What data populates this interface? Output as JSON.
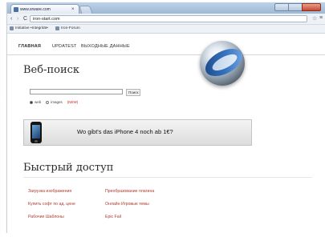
{
  "browser": {
    "tab_title": "www.srware.com",
    "tab_close": "×",
    "url": "iron-start.com",
    "nav": {
      "back": "‹",
      "forward": "›",
      "reload": "C"
    },
    "star": "☆",
    "wrench": "🔧",
    "bookmarks": [
      {
        "label": "Initiative •Integrität•"
      },
      {
        "label": "Iron-Forum"
      }
    ]
  },
  "site": {
    "nav": [
      "ГЛАВНАЯ",
      "UPDATEST",
      "ВЫХОДНЫЕ ДАННЫЕ"
    ],
    "web_search": {
      "title": "Веб-поиск",
      "button": "Поиск",
      "options": [
        {
          "label": "web",
          "selected": true
        },
        {
          "label": "images",
          "selected": false
        }
      ],
      "beta": "(NEW)"
    },
    "promo": {
      "text": "Wo gibt's das iPhone 4 noch ab 1€?"
    },
    "quick_access": {
      "title": "Быстрый доступ",
      "links": [
        [
          "Загрузка изображения",
          "Преобразование плагина"
        ],
        [
          "Купить софт по ад. цене",
          "Онлайн Игровые темы"
        ],
        [
          "Рабочие Шаблоны",
          "Epic Fail"
        ]
      ]
    }
  },
  "colors": {
    "link": "#b13a2e",
    "titlebar": "#bcd3ea",
    "logo_blue": "#2f6fc1"
  },
  "icons": [
    "favicon-icon",
    "back-icon",
    "forward-icon",
    "reload-icon",
    "star-icon",
    "wrench-icon",
    "bookmark-icon",
    "logo-sphere-icon",
    "iphone-image"
  ]
}
